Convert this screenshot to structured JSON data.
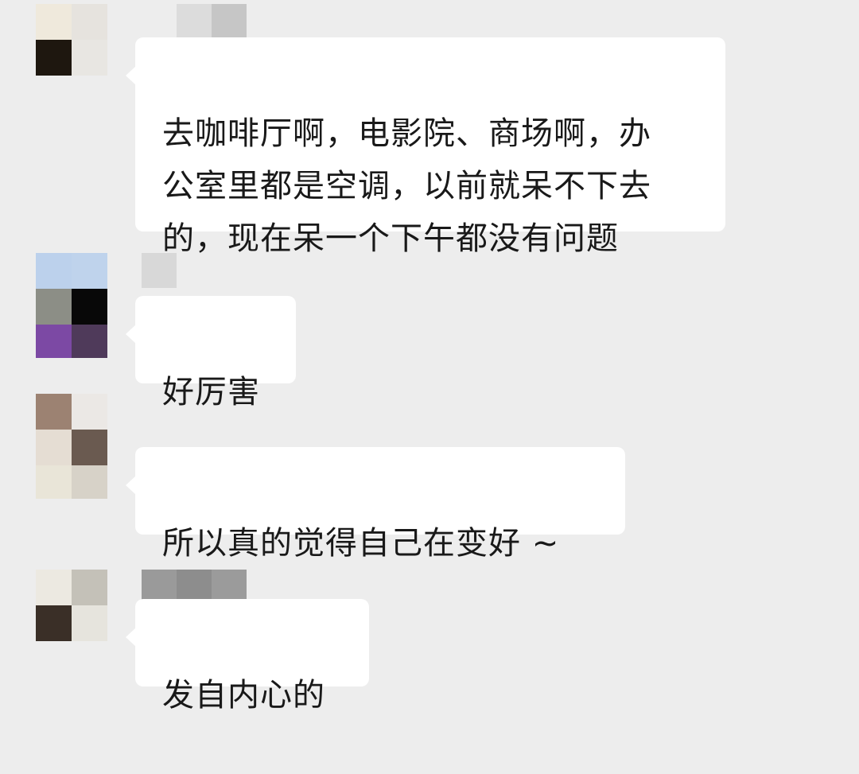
{
  "messages": [
    {
      "text": "去咖啡厅啊，电影院、商场啊，办\n公室里都是空调，以前就呆不下去\n的，现在呆一个下午都没有问题",
      "avatar_colors": [
        "#efe9dc",
        "#e6e3de",
        "#1e170f",
        "#e8e6e2"
      ],
      "name_colors": [
        "#dcdcdc",
        "#c6c6c6"
      ]
    },
    {
      "text": "好厉害",
      "avatar_colors": [
        "#bcd1ec",
        "#bfd3ec",
        "#8c8e86",
        "#080808",
        "#7c49a4",
        "#4f3a5a"
      ],
      "name_colors": [
        "#d8d8d8"
      ]
    },
    {
      "text": "所以真的觉得自己在变好 ~",
      "avatar_colors": [
        "#9c8272",
        "#ebe8e5",
        "#e5ddd3",
        "#6a5a50",
        "#e9e5d8",
        "#d7d2c8"
      ],
      "name_colors": []
    },
    {
      "text": "发自内心的",
      "avatar_colors": [
        "#ece9e1",
        "#c4c1b8",
        "#3a2f27",
        "#e6e4dd"
      ],
      "name_colors": [
        "#9a9a9a",
        "#8d8d8d",
        "#9b9b9b"
      ]
    }
  ]
}
